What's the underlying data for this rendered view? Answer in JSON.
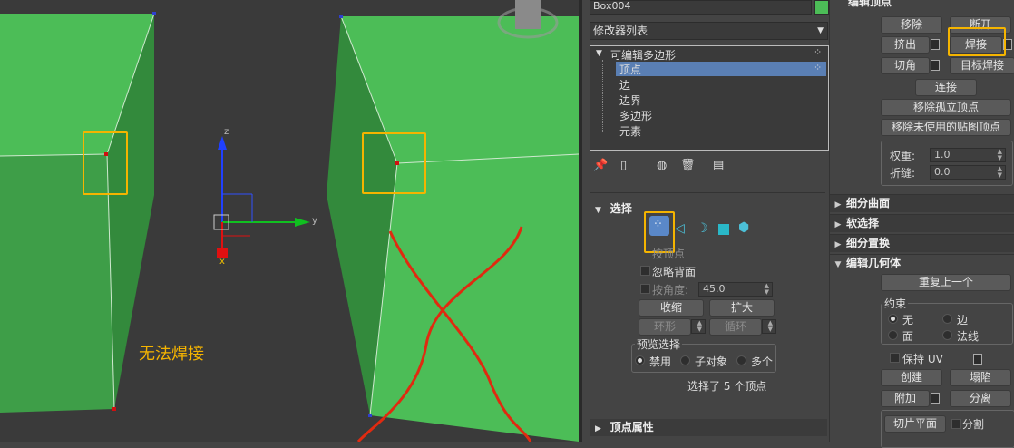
{
  "viewport": {
    "annotation": "无法焊接",
    "axis_labels": {
      "z": "z",
      "y": "y",
      "x": "x"
    },
    "colors": {
      "box": "#4cbd57",
      "box_dark": "#3a9a44",
      "highlight": "#f5b400",
      "cross": "#e02a10"
    }
  },
  "command_panel": {
    "object_name": "Box004",
    "modifier_list": "修改器列表",
    "stack": {
      "root": "可编辑多边形",
      "items": [
        "顶点",
        "边",
        "边界",
        "多边形",
        "元素"
      ],
      "selected_index": 0
    },
    "selection": {
      "title": "选择",
      "level_label": "按顶点",
      "ignore_backfacing": "忽略背面",
      "by_angle": "按角度:",
      "angle_value": "45.0",
      "shrink": "收缩",
      "grow": "扩大",
      "ring": "环形",
      "loop": "循环",
      "preview_title": "预览选择",
      "preview_options": [
        "禁用",
        "子对象",
        "多个"
      ],
      "status": "选择了 5 个顶点"
    },
    "vertex_props_title": "顶点属性"
  },
  "right_panel": {
    "edit_vertices_title": "编辑顶点",
    "remove": "移除",
    "break": "断开",
    "extrude": "挤出",
    "weld": "焊接",
    "chamfer": "切角",
    "target_weld": "目标焊接",
    "connect": "连接",
    "remove_isolated": "移除孤立顶点",
    "remove_unused_map": "移除未使用的贴图顶点",
    "weight_label": "权重:",
    "weight_value": "1.0",
    "crease_label": "折缝:",
    "crease_value": "0.0",
    "rollouts": [
      "细分曲面",
      "软选择",
      "细分置换"
    ],
    "edit_geometry_title": "编辑几何体",
    "repeat_last": "重复上一个",
    "constraints_title": "约束",
    "constraints": [
      "无",
      "边",
      "面",
      "法线"
    ],
    "preserve_uv": "保持 UV",
    "create": "创建",
    "collapse": "塌陷",
    "attach": "附加",
    "detach": "分离",
    "slice_plane": "切片平面",
    "split": "分割"
  }
}
